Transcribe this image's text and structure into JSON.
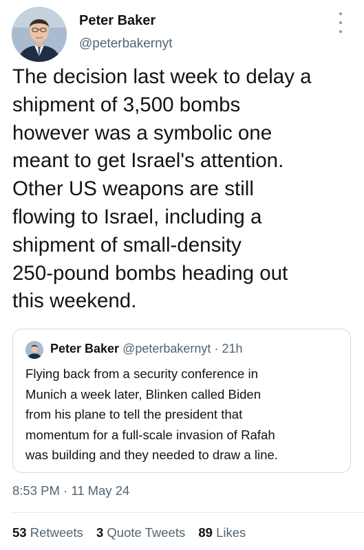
{
  "tweet": {
    "author_name": "Peter Baker",
    "author_handle": "@peterbakernyt",
    "text": "The decision last week to delay a\nshipment of 3,500 bombs\nhowever was a symbolic one\nmeant to get Israel's attention.\nOther US weapons are still\nflowing to Israel, including a\nshipment of small-density\n250-pound bombs heading out\nthis weekend.",
    "timestamp": "8:53 PM · 11 May 24"
  },
  "quoted_tweet": {
    "author_name": "Peter Baker",
    "author_handle": "@peterbakernyt",
    "separator": " · ",
    "age": "21h",
    "text": "Flying back from a security conference in\nMunich a week later, Blinken called Biden\nfrom his plane to tell the president that\nmomentum for a full-scale invasion of Rafah\nwas building and they needed to draw a line."
  },
  "stats": {
    "retweets_count": "53",
    "retweets_label": "Retweets",
    "quotes_count": "3",
    "quotes_label": "Quote Tweets",
    "likes_count": "89",
    "likes_label": "Likes"
  },
  "icons": {
    "more": "more-vertical-icon"
  },
  "colors": {
    "text_primary": "#0f1419",
    "text_secondary": "#536471",
    "border": "#cfd9de"
  }
}
